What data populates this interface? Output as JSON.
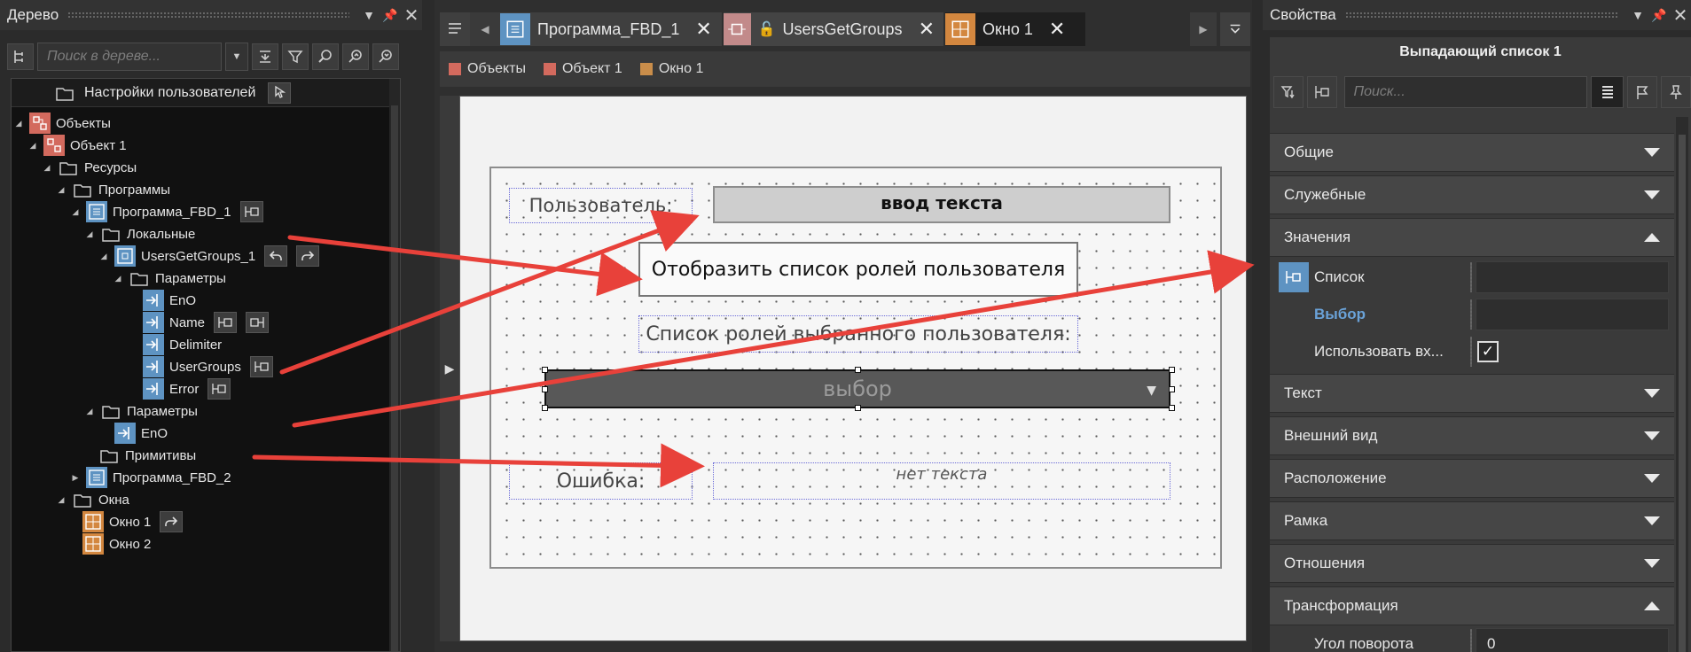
{
  "tree": {
    "title": "Дерево",
    "search_placeholder": "Поиск в дереве...",
    "header_label": "Настройки пользователей",
    "nodes": [
      {
        "label": "Объекты"
      },
      {
        "label": "Объект 1"
      },
      {
        "label": "Ресурсы"
      },
      {
        "label": "Программы"
      },
      {
        "label": "Программа_FBD_1"
      },
      {
        "label": "Локальные"
      },
      {
        "label": "UsersGetGroups_1"
      },
      {
        "label": "Параметры"
      },
      {
        "label": "EnO"
      },
      {
        "label": "Name"
      },
      {
        "label": "Delimiter"
      },
      {
        "label": "UserGroups"
      },
      {
        "label": "Error"
      },
      {
        "label": "Параметры"
      },
      {
        "label": "EnO"
      },
      {
        "label": "Примитивы"
      },
      {
        "label": "Программа_FBD_2"
      },
      {
        "label": "Окна"
      },
      {
        "label": "Окно 1"
      },
      {
        "label": "Окно 2"
      }
    ]
  },
  "editor": {
    "tabs": [
      {
        "label": "Программа_FBD_1"
      },
      {
        "label": "UsersGetGroups"
      },
      {
        "label": "Окно 1"
      }
    ],
    "breadcrumbs": [
      {
        "label": "Объекты",
        "color": "#d36a5e"
      },
      {
        "label": "Объект 1",
        "color": "#d36a5e"
      },
      {
        "label": "Окно 1",
        "color": "#c98d4a"
      }
    ],
    "form": {
      "user_label": "Пользователь:",
      "text_input": "ввод текста",
      "show_button": "Отобразить список ролей пользователя",
      "list_label": "Список ролей выбранного пользователя:",
      "combo_value": "выбор",
      "error_label": "Ошибка:",
      "error_text": "нет текста"
    }
  },
  "props": {
    "title": "Свойства",
    "object_title": "Выпадающий список 1",
    "search_placeholder": "Поиск...",
    "groups": {
      "general": "Общие",
      "service": "Служебные",
      "values": "Значения",
      "text": "Текст",
      "appearance": "Внешний вид",
      "location": "Расположение",
      "frame": "Рамка",
      "relations": "Отношения",
      "transform": "Трансформация"
    },
    "rows": {
      "list": {
        "name": "Список",
        "value": ""
      },
      "choice": {
        "name": "Выбор",
        "value": ""
      },
      "use_input": {
        "name": "Использовать вх...",
        "checked": true
      },
      "rotation": {
        "name": "Угол поворота",
        "value": "0"
      }
    }
  },
  "colors": {
    "accent_red_arrow": "#e8413a",
    "object_icon": "#d36a5e",
    "program_icon": "#5e93c2",
    "window_icon": "#d3873f",
    "choice_text": "#6aa2d8"
  }
}
